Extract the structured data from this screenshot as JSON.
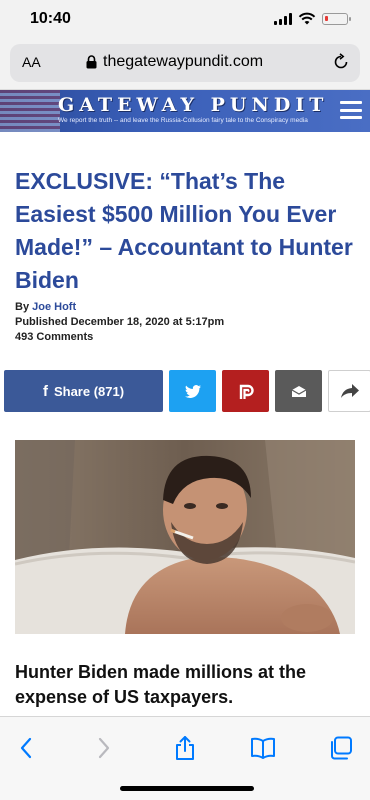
{
  "status_bar": {
    "time": "10:40"
  },
  "browser": {
    "text_size_label": "AA",
    "url": "thegatewaypundit.com"
  },
  "site": {
    "logo": "GATEWAY PUNDIT",
    "tagline": "We report the truth -- and leave the Russia-Collusion fairy tale to the Conspiracy media"
  },
  "article": {
    "headline": "EXCLUSIVE: “That’s The Easiest $500 Million You Ever Made!” – Accountant to Hunter Biden",
    "by_label": "By",
    "author": "Joe Hoft",
    "published": "Published December 18, 2020 at 5:17pm",
    "comments": "493 Comments",
    "subhead": "Hunter Biden made millions at the expense of US taxpayers."
  },
  "share": {
    "facebook_label": "Share (871)"
  },
  "icons": {
    "lock": "lock-icon",
    "reload": "reload-icon",
    "menu": "hamburger-menu-icon",
    "facebook": "facebook-icon",
    "twitter": "twitter-icon",
    "parler": "parler-icon",
    "email": "email-icon",
    "share": "share-arrow-icon",
    "back": "chevron-left-icon",
    "forward": "chevron-right-icon",
    "share_sheet": "share-sheet-icon",
    "bookmarks": "bookmarks-icon",
    "tabs": "tabs-icon"
  },
  "colors": {
    "headline": "#2c4a9a",
    "facebook": "#3b5998",
    "twitter": "#1da1f2",
    "parler": "#b41f1f",
    "email": "#5a5a5a",
    "ios_blue": "#007aff"
  }
}
